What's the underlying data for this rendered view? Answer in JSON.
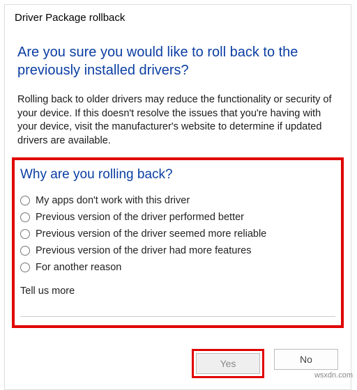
{
  "dialog": {
    "title": "Driver Package rollback",
    "heading": "Are you sure you would like to roll back to the previously installed drivers?",
    "description": "Rolling back to older drivers may reduce the functionality or security of your device. If this doesn't resolve the issues that you're having with your device, visit the manufacturer's website to determine if updated drivers are available.",
    "reason_heading": "Why are you rolling back?",
    "reasons": [
      "My apps don't work with this driver",
      "Previous version of the driver performed better",
      "Previous version of the driver seemed more reliable",
      "Previous version of the driver had more features",
      "For another reason"
    ],
    "tell_us_label": "Tell us more",
    "tell_us_value": "",
    "yes_label": "Yes",
    "no_label": "No"
  },
  "watermark": "wsxdn.com"
}
